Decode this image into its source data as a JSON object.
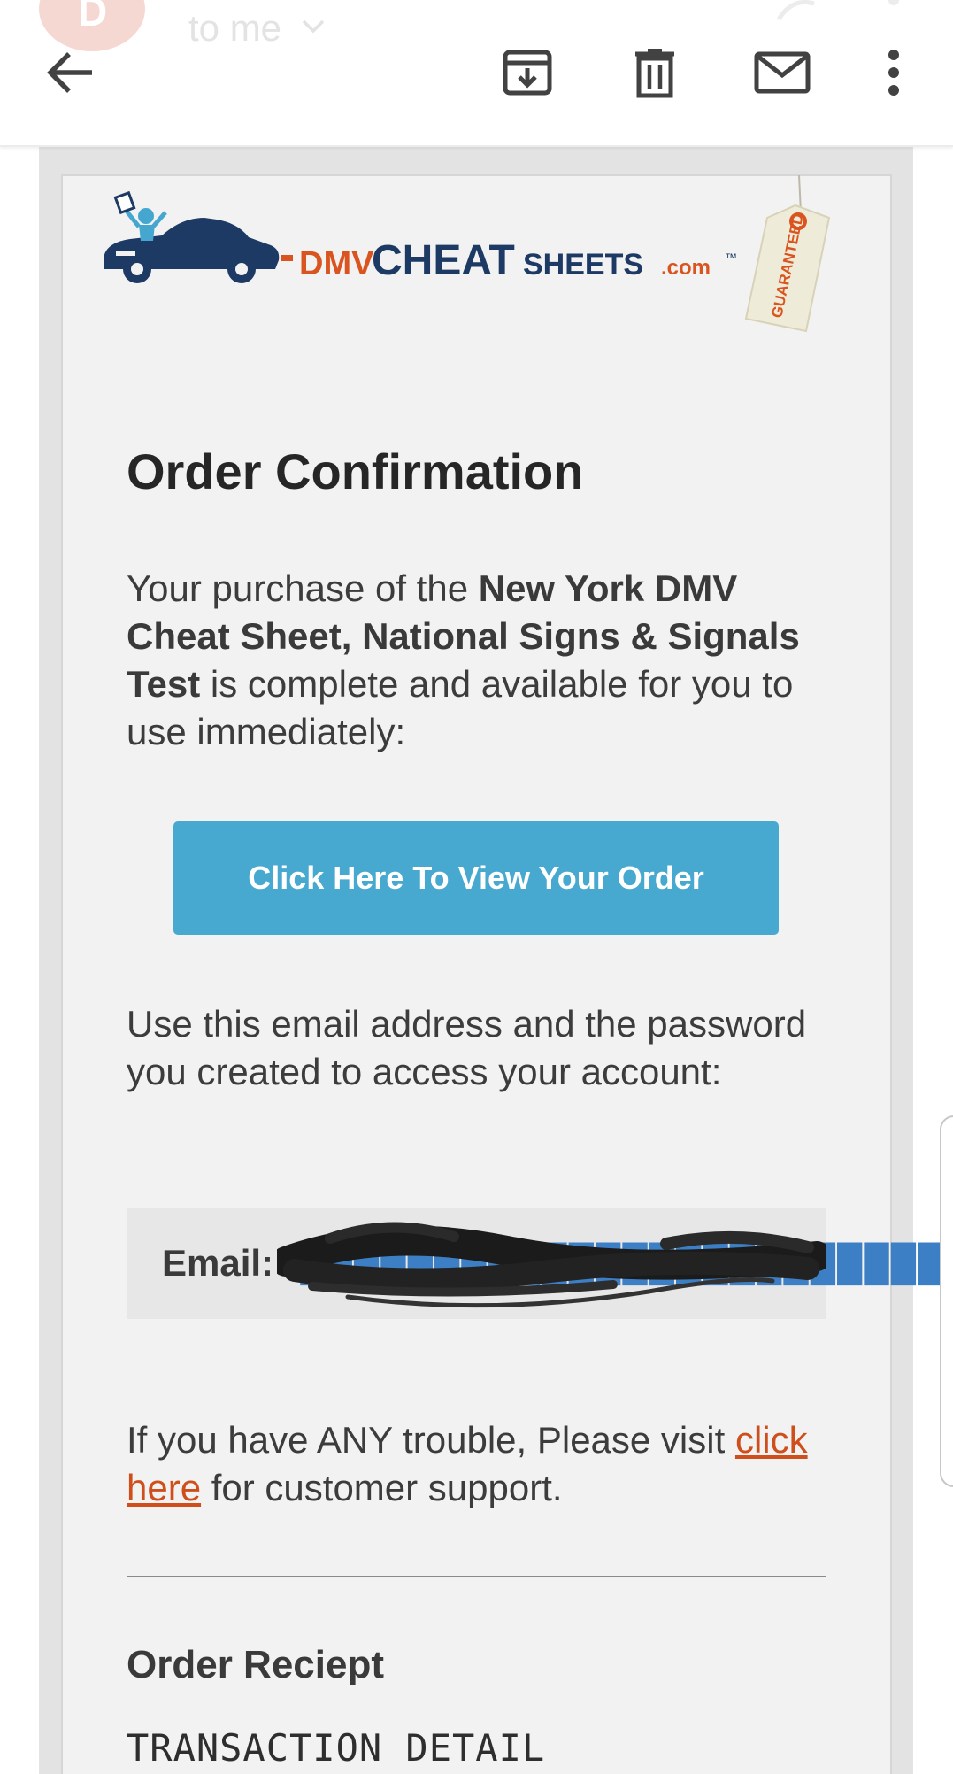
{
  "header": {
    "sender_initial": "D",
    "recipient_label": "to me",
    "icons": [
      "arrow-back-icon",
      "archive-icon",
      "delete-icon",
      "mark-unread-icon",
      "more-vert-icon"
    ]
  },
  "email": {
    "logo_text": {
      "dmv": "DMV",
      "cheat": "CHEAT",
      "sheets": "SHEETS",
      "com": ".com",
      "tm": "™",
      "tag": "GUARANTEED"
    },
    "title": "Order Confirmation",
    "purchase": {
      "prefix": "Your purchase of the ",
      "product": "New York DMV Cheat Sheet, National Signs & Signals Test",
      "suffix": " is complete and available for you to use immediately:"
    },
    "cta_label": "Click Here To View Your Order",
    "account_text": "Use this email address and the password you created to access your account:",
    "email_label": "Email:",
    "email_value": "d█████████████████████████",
    "support": {
      "prefix": "If you have ANY trouble, Please visit ",
      "link_text": "click here",
      "suffix": " for customer support."
    },
    "receipt_heading": "Order Reciept",
    "transaction_heading": "TRANSACTION DETAIL"
  },
  "colors": {
    "cta": "#48a9d0",
    "link": "#cf4f1c",
    "logo_orange": "#d9541e",
    "logo_navy": "#1c3a63"
  }
}
